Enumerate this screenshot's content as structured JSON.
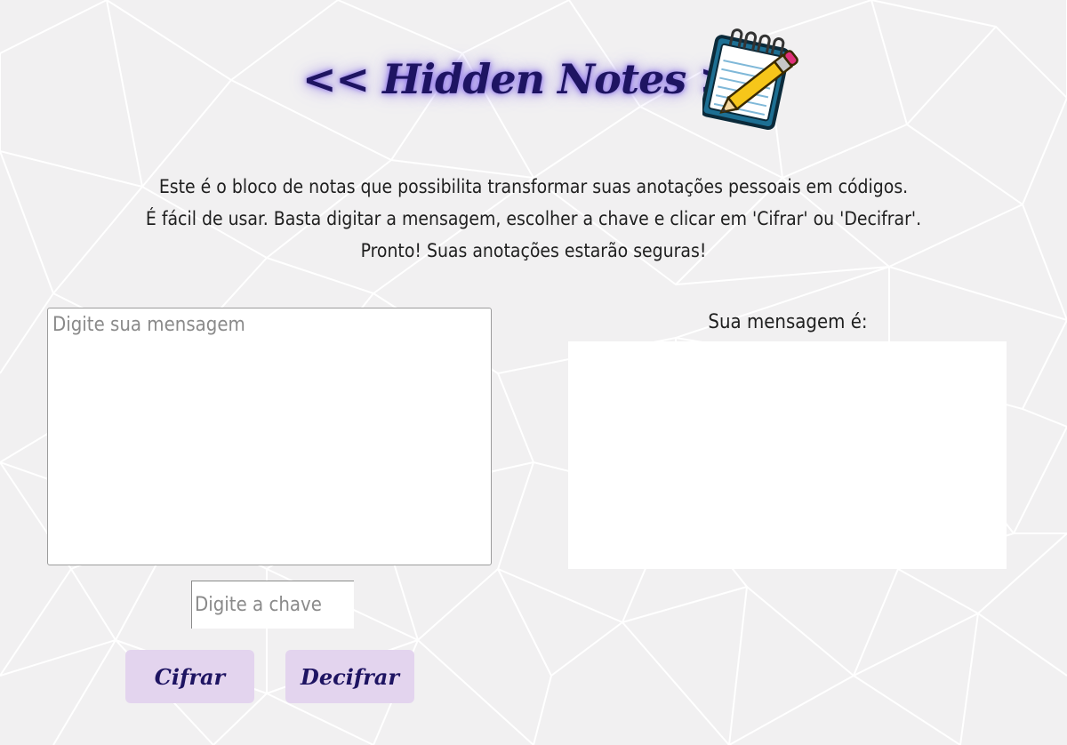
{
  "header": {
    "title": "<< Hidden Notes >>",
    "icon": "notepad-pencil-icon"
  },
  "intro": {
    "line1": "Este é o bloco de notas que possibilita transformar suas anotações pessoais em códigos.",
    "line2": "É fácil de usar. Basta digitar a mensagem, escolher a chave e clicar em 'Cifrar' ou 'Decifrar'.",
    "line3": "Pronto! Suas anotações estarão seguras!"
  },
  "message": {
    "value": "",
    "placeholder": "Digite sua mensagem"
  },
  "key": {
    "value": "",
    "placeholder": "Digite a chave"
  },
  "buttons": {
    "encrypt_label": "Cifrar",
    "decrypt_label": "Decifrar"
  },
  "result": {
    "label": "Sua mensagem é:",
    "value": ""
  },
  "colors": {
    "background": "#f1f0f1",
    "title": "#1e1462",
    "title_glow": "#785ae6",
    "button_bg": "#e3d4ee",
    "button_text": "#1e1462"
  }
}
